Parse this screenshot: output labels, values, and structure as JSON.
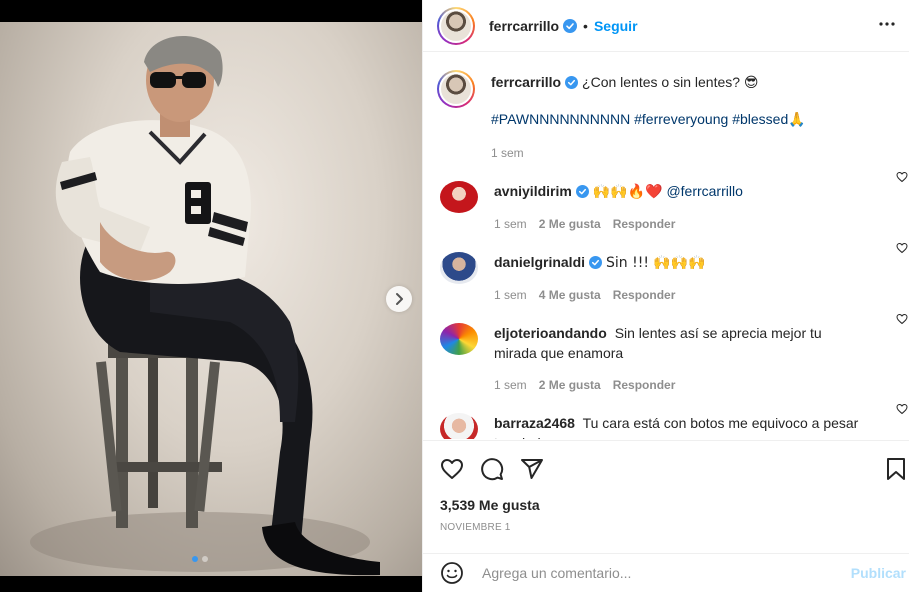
{
  "post": {
    "author": "ferrcarrillo",
    "follow_label": "Seguir",
    "separator": "•",
    "caption_text": "¿Con lentes o sin lentes?",
    "caption_emoji": "😎",
    "hashtags": [
      "#PAWNNNNNNNNNN",
      "#ferreveryoung",
      "#blessed"
    ],
    "hashtag_emoji": "🙏",
    "caption_time": "1 sem",
    "likes": "3,539 Me gusta",
    "date": "NOVIEMBRE 1",
    "media_dots": 2,
    "media_active_index": 0
  },
  "comments": [
    {
      "user": "avniyildirim",
      "verified": true,
      "text": "🙌🙌🔥❤️",
      "mention": "@ferrcarrillo",
      "time": "1 sem",
      "likes": "2 Me gusta",
      "reply": "Responder"
    },
    {
      "user": "danielgrinaldi",
      "verified": true,
      "text": "Sin !!! 🙌🙌🙌",
      "mention": "",
      "time": "1 sem",
      "likes": "4 Me gusta",
      "reply": "Responder"
    },
    {
      "user": "eljoterioandando",
      "verified": false,
      "text": "Sin lentes así se aprecia mejor tu mirada que enamora",
      "mention": "",
      "time": "1 sem",
      "likes": "2 Me gusta",
      "reply": "Responder"
    },
    {
      "user": "barraza2468",
      "verified": false,
      "text": "Tu cara está con botos me equivoco a pesar tu edad..",
      "mention": "",
      "time": "",
      "likes": "",
      "reply": ""
    }
  ],
  "comment_box": {
    "placeholder": "Agrega un comentario...",
    "publish_label": "Publicar"
  },
  "colors": {
    "link_blue": "#0095f6",
    "hashtag_blue": "#00376b",
    "verified_blue": "#3897f0",
    "muted_gray": "#8e8e8e",
    "publish_disabled": "#b2dffc"
  },
  "icons": {
    "more": "more-options-icon",
    "like": "heart-icon",
    "comment": "comment-icon",
    "share": "share-icon",
    "save": "bookmark-icon",
    "emoji": "emoji-icon",
    "next": "chevron-right-icon"
  }
}
